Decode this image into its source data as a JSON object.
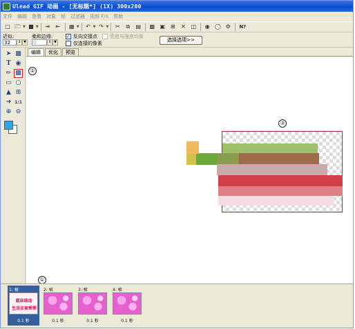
{
  "window": {
    "title": "Ulead GIF 动画 - [无标题*] (1X) 300x200"
  },
  "menu": [
    "文件",
    "编辑",
    "查看",
    "对象",
    "帧",
    "过滤器",
    "视频 F/X",
    "帮助"
  ],
  "toolbar": {
    "icons": [
      "new-icon",
      "open-icon",
      "save-icon",
      "import-icon",
      "export-icon",
      "preview-icon",
      "undo-icon",
      "redo-icon",
      "cut-icon",
      "copy-icon",
      "paste-icon",
      "layer-icon",
      "frame-icon",
      "crop-icon",
      "delete-icon",
      "optimize-icon",
      "web-icon",
      "globe-icon",
      "help-icon"
    ],
    "help_glyph": "N?"
  },
  "options": {
    "tolerance_label": "近似:",
    "tolerance_value": "32",
    "soft_edge_label": "柔和边缘:",
    "soft_edge_value": "0",
    "invert_label": "反向交接点",
    "invert_checked": true,
    "contiguous_label": "仅连接的像素",
    "contiguous_checked": false,
    "hue_label": "亮度与强度均衡",
    "hue_checked": false,
    "select_button": "选择选项>>"
  },
  "tabs": [
    "编辑",
    "优化",
    "预览"
  ],
  "active_tab": "编辑",
  "tools": [
    "pointer-tool",
    "crop-tool",
    "text-tool",
    "shape-tool",
    "brush-tool",
    "magic-wand-tool",
    "eraser-tool",
    "lasso-tool",
    "fill-tool",
    "grid-tool",
    "eyedropper-tool",
    "actual-size-tool",
    "zoom-in-tool",
    "zoom-out-tool"
  ],
  "tool_labels": {
    "text": "T",
    "actual_size": "1:1"
  },
  "colors": {
    "foreground": "#29a9e6",
    "background": "#ffffff",
    "selection_border": "#d01f1f",
    "canvas_border": "#a52a2a",
    "frame_selected": "#34609e"
  },
  "callouts": [
    "①",
    "②",
    "③"
  ],
  "frames": [
    {
      "label": "1: 帧",
      "time": "0.1 秒",
      "selected": true,
      "text_lines": [
        "鼠床结动",
        "生活买卖帮帮"
      ]
    },
    {
      "label": "2: 帧",
      "time": "0.1 秒",
      "selected": false
    },
    {
      "label": "3: 帧",
      "time": "0.1 秒",
      "selected": false
    },
    {
      "label": "4: 帧",
      "time": "0.1 秒",
      "selected": false
    }
  ]
}
